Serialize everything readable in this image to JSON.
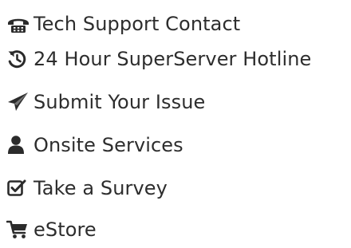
{
  "menu": {
    "items": [
      {
        "label": "Tech Support Contact",
        "icon": "support-phone-icon"
      },
      {
        "label": "24 Hour SuperServer Hotline",
        "icon": "history-icon"
      },
      {
        "label": "Submit Your Issue",
        "icon": "paper-plane-icon"
      },
      {
        "label": "Onsite Services",
        "icon": "user-icon"
      },
      {
        "label": "Take a Survey",
        "icon": "checkbox-icon"
      },
      {
        "label": "eStore",
        "icon": "shopping-cart-icon"
      }
    ]
  },
  "colors": {
    "text": "#2d2d2d",
    "icon": "#2b2b2b",
    "background": "#ffffff"
  }
}
